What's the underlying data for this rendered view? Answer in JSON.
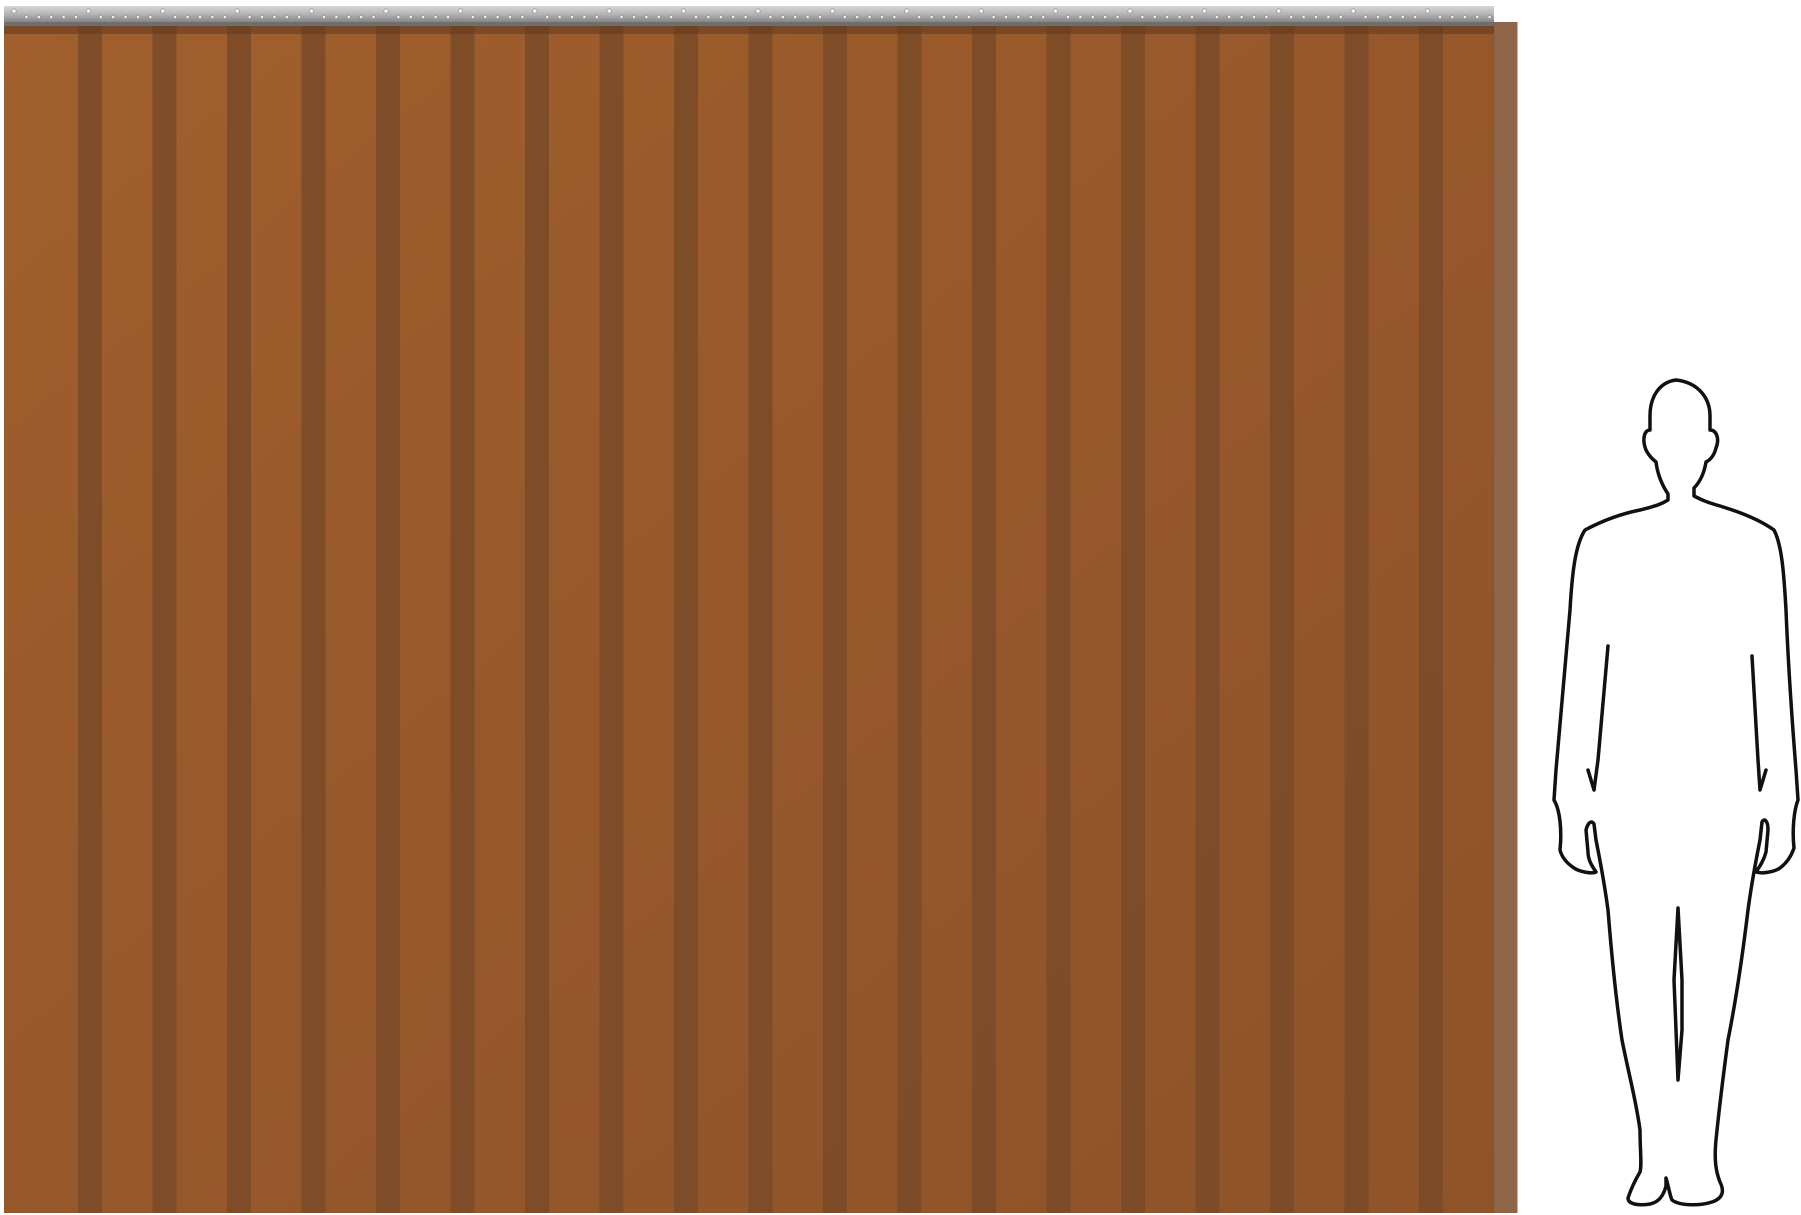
{
  "scene": {
    "subject": "strip-curtain",
    "strip_count": 20,
    "colors": {
      "background": "#ffffff",
      "curtain_base": "#9a5c2c",
      "curtain_overlap": "#7a4a28",
      "rail_light": "#c9c9c9",
      "rail_dark": "#8a8a8a",
      "rail_holes": "#f2f2f2",
      "silhouette_fill": "#ffffff",
      "silhouette_stroke": "#111111"
    },
    "icons": {
      "rail": "mounting-rail",
      "figure": "person-silhouette-icon"
    }
  }
}
